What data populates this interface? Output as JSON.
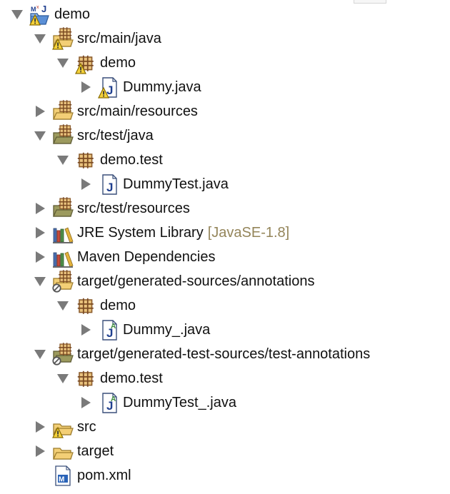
{
  "colors": {
    "decoration": "#94855a",
    "folder": "#efc96a",
    "package": "#a67c48",
    "java_blue": "#1f3f8f",
    "annotation_green": "#3c8c3c",
    "twistie": "#7a7a7a"
  },
  "tree": {
    "items": [
      {
        "label": "demo",
        "icon": "maven-project-icon",
        "twistie": "expanded",
        "level": 0,
        "warning": true
      },
      {
        "label": "src/main/java",
        "icon": "source-folder-icon",
        "twistie": "expanded",
        "level": 1,
        "warning": true
      },
      {
        "label": "demo",
        "icon": "package-icon",
        "twistie": "expanded",
        "level": 2,
        "warning": true
      },
      {
        "label": "Dummy.java",
        "icon": "java-file-icon",
        "twistie": "collapsed",
        "level": 3,
        "warning": true
      },
      {
        "label": "src/main/resources",
        "icon": "source-folder-icon",
        "twistie": "collapsed",
        "level": 1
      },
      {
        "label": "src/test/java",
        "icon": "test-source-folder-icon",
        "twistie": "expanded",
        "level": 1
      },
      {
        "label": "demo.test",
        "icon": "package-icon",
        "twistie": "expanded",
        "level": 2
      },
      {
        "label": "DummyTest.java",
        "icon": "java-file-icon",
        "twistie": "collapsed",
        "level": 3
      },
      {
        "label": "src/test/resources",
        "icon": "test-source-folder-icon",
        "twistie": "collapsed",
        "level": 1
      },
      {
        "label": "JRE System Library",
        "decoration": "[JavaSE-1.8]",
        "icon": "library-icon",
        "twistie": "collapsed",
        "level": 1
      },
      {
        "label": "Maven Dependencies",
        "icon": "library-icon",
        "twistie": "collapsed",
        "level": 1
      },
      {
        "label": "target/generated-sources/annotations",
        "icon": "generated-source-folder-icon",
        "twistie": "expanded",
        "level": 1
      },
      {
        "label": "demo",
        "icon": "package-icon",
        "twistie": "expanded",
        "level": 2
      },
      {
        "label": "Dummy_.java",
        "icon": "generated-java-file-icon",
        "twistie": "collapsed",
        "level": 3
      },
      {
        "label": "target/generated-test-sources/test-annotations",
        "icon": "generated-test-source-folder-icon",
        "twistie": "expanded",
        "level": 1
      },
      {
        "label": "demo.test",
        "icon": "package-icon",
        "twistie": "expanded",
        "level": 2
      },
      {
        "label": "DummyTest_.java",
        "icon": "generated-java-file-icon",
        "twistie": "collapsed",
        "level": 3
      },
      {
        "label": "src",
        "icon": "folder-icon",
        "twistie": "collapsed",
        "level": 1,
        "warning": true
      },
      {
        "label": "target",
        "icon": "folder-icon",
        "twistie": "collapsed",
        "level": 1
      },
      {
        "label": "pom.xml",
        "icon": "pom-file-icon",
        "twistie": "none",
        "level": 1
      }
    ]
  }
}
